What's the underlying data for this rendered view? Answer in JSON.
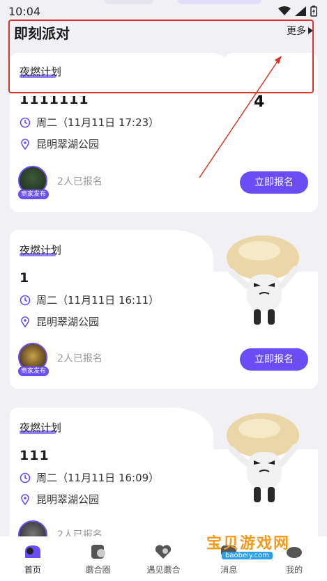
{
  "status_bar": {
    "time": "10:04"
  },
  "header": {
    "title": "即刻派对",
    "more_label": "更多"
  },
  "annotation": {
    "number": "4"
  },
  "cards": [
    {
      "plan_label": "夜燃计划",
      "title": "1111111",
      "date": "周二（11月11日 17:23）",
      "location": "昆明翠湖公园",
      "merchant_tag": "商家发布",
      "signup_count": "2人已报名",
      "signup_label": "立即报名"
    },
    {
      "plan_label": "夜燃计划",
      "title": "1",
      "date": "周二（11月11日 16:11）",
      "location": "昆明翠湖公园",
      "merchant_tag": "商家发布",
      "signup_count": "2人已报名",
      "signup_label": "立即报名"
    },
    {
      "plan_label": "夜燃计划",
      "title": "111",
      "date": "周二（11月11日 16:09）",
      "location": "昆明翠湖公园",
      "merchant_tag": "",
      "signup_count": "2人已报名",
      "signup_label": ""
    }
  ],
  "tab_bar": {
    "items": [
      {
        "label": "首页",
        "icon": "home-icon"
      },
      {
        "label": "蘑合圈",
        "icon": "circle-icon"
      },
      {
        "label": "遇见蘑合",
        "icon": "heart-icon"
      },
      {
        "label": "消息",
        "icon": "message-icon"
      },
      {
        "label": "我的",
        "icon": "profile-icon"
      }
    ]
  },
  "watermark": {
    "text": "宝贝游戏网",
    "url": "baobeiy.com"
  },
  "colors": {
    "accent": "#6a4df4",
    "annotation": "#d9362b",
    "background": "#f1f0f5"
  }
}
